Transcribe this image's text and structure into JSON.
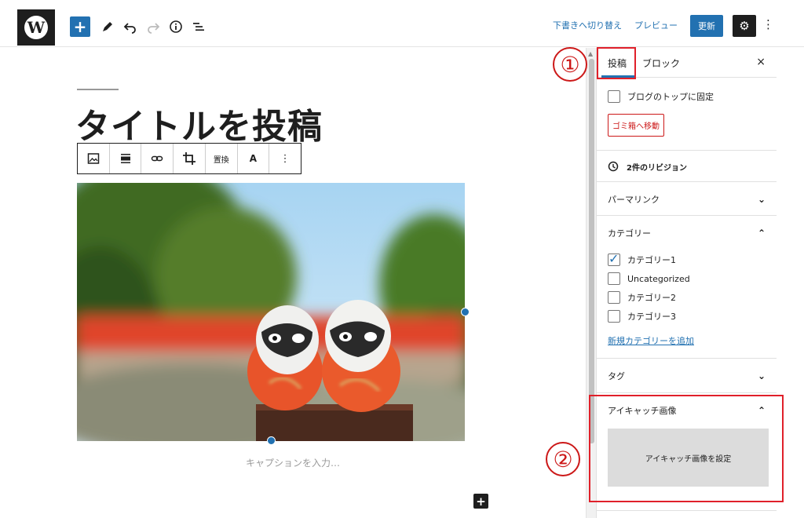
{
  "topbar": {
    "logo_glyph": "W",
    "add_icon": "plus-icon",
    "tools": [
      "pencil-icon",
      "undo-icon",
      "redo-icon",
      "info-icon",
      "list-view-icon"
    ],
    "switch_draft_label": "下書きへ切り替え",
    "preview_label": "プレビュー",
    "update_label": "更新",
    "settings_icon": "gear-icon",
    "more_icon": "more-vertical-icon"
  },
  "editor": {
    "post_title": "タイトルを投稿",
    "block_toolbar": {
      "tools": [
        "image-icon",
        "align-icon",
        "link-icon",
        "crop-icon",
        "置換",
        "A",
        "more-icon"
      ]
    },
    "caption_placeholder": "キャプションを入力…",
    "append_icon": "plus-icon"
  },
  "sidebar": {
    "tabs": {
      "post": "投稿",
      "block": "ブロック",
      "close": "×"
    },
    "sticky_label": "ブログのトップに固定",
    "trash_label": "ゴミ箱へ移動",
    "revisions_label": "2件のリビジョン",
    "permalink_label": "パーマリンク",
    "category_label": "カテゴリー",
    "categories": [
      {
        "name": "カテゴリー1",
        "checked": true
      },
      {
        "name": "Uncategorized",
        "checked": false
      },
      {
        "name": "カテゴリー2",
        "checked": false
      },
      {
        "name": "カテゴリー3",
        "checked": false
      }
    ],
    "add_category_label": "新規カテゴリーを追加",
    "tag_label": "タグ",
    "featured_label": "アイキャッチ画像",
    "set_featured_label": "アイキャッチ画像を設定"
  },
  "annotations": {
    "one": "①",
    "two": "②"
  },
  "colors": {
    "accent": "#2271b1",
    "danger": "#cc1818",
    "annotation": "#e0202a"
  }
}
